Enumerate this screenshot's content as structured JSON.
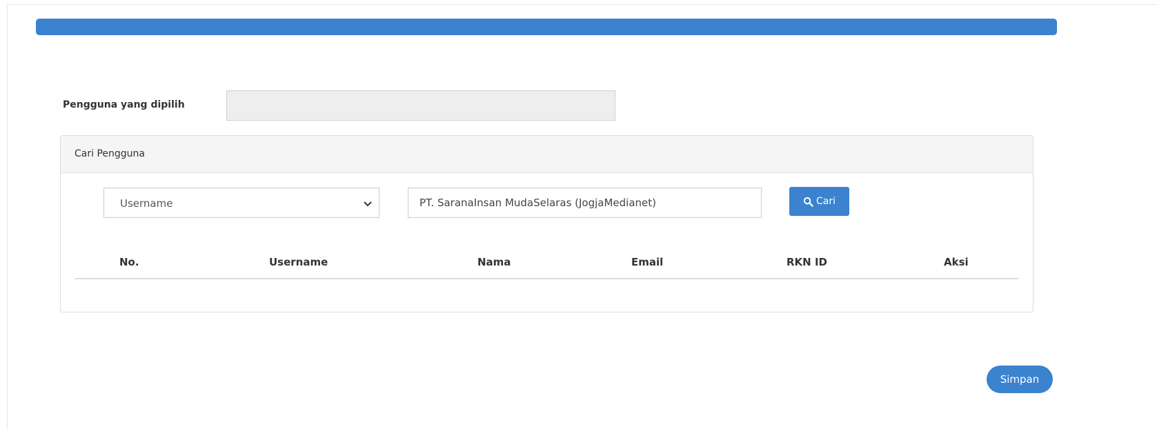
{
  "selected_user": {
    "label": "Pengguna yang dipilih",
    "value": ""
  },
  "search_panel": {
    "title": "Cari Pengguna",
    "filter_field": "Username",
    "query": "PT. SaranaInsan MudaSelaras (JogjaMedianet)",
    "search_button": "Cari",
    "search_icon": "search-icon"
  },
  "table": {
    "columns": [
      "No.",
      "Username",
      "Nama",
      "Email",
      "RKN ID",
      "Aksi"
    ],
    "rows": []
  },
  "actions": {
    "save_label": "Simpan"
  },
  "colors": {
    "primary": "#3b82cf",
    "panel_header": "#f5f5f5",
    "readonly_input": "#eeeeee"
  }
}
